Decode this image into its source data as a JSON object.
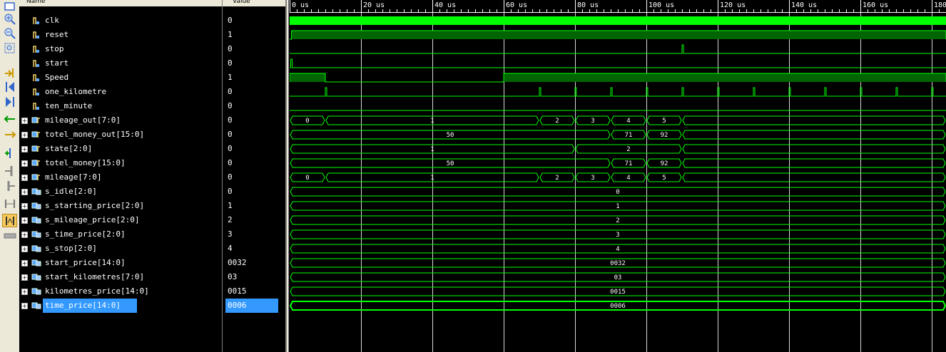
{
  "columns": {
    "name": "Name",
    "value": "Value"
  },
  "toolbar": {
    "buttons": [
      "zoom-fit-icon",
      "zoom-in-icon",
      "zoom-out-icon",
      "zoom-full-icon",
      "goto-cursor-icon",
      "goto-start-icon",
      "goto-end-icon",
      "prev-transition-icon",
      "next-transition-icon",
      "add-marker-icon",
      "prev-marker-icon",
      "next-marker-icon",
      "swap-cursors-icon",
      "snap-to-transition-icon",
      "float-ruler-icon"
    ]
  },
  "timeline": {
    "labels": [
      "0 us",
      "20 us",
      "40 us",
      "60 us",
      "80 us",
      "100 us",
      "120 us",
      "140 us",
      "160 us",
      "180"
    ]
  },
  "signals": [
    {
      "name": "clk",
      "value": "0",
      "kind": "bit",
      "wave": {
        "type": "clock"
      }
    },
    {
      "name": "reset",
      "value": "1",
      "kind": "bit",
      "wave": {
        "type": "level",
        "high": [
          [
            0.5,
            184
          ]
        ]
      }
    },
    {
      "name": "stop",
      "value": "0",
      "kind": "bit",
      "wave": {
        "type": "pulses",
        "at": [
          110
        ]
      }
    },
    {
      "name": "start",
      "value": "0",
      "kind": "bit",
      "wave": {
        "type": "pulses",
        "at": [
          0.3
        ]
      }
    },
    {
      "name": "Speed",
      "value": "1",
      "kind": "bit",
      "wave": {
        "type": "level",
        "high": [
          [
            0,
            10
          ],
          [
            60,
            184
          ]
        ]
      }
    },
    {
      "name": "one_kilometre",
      "value": "0",
      "kind": "bit",
      "wave": {
        "type": "pulses",
        "at": [
          10,
          70,
          80,
          90,
          100,
          110,
          120,
          130,
          140,
          150,
          160,
          170,
          180
        ]
      }
    },
    {
      "name": "ten_minute",
      "value": "0",
      "kind": "bit",
      "wave": {
        "type": "low"
      }
    },
    {
      "name": "mileage_out[7:0]",
      "value": "0",
      "kind": "bus",
      "wave": {
        "type": "bus",
        "segments": [
          [
            0,
            10,
            "0"
          ],
          [
            10,
            70,
            "1"
          ],
          [
            70,
            80,
            "2"
          ],
          [
            80,
            90,
            "3"
          ],
          [
            90,
            100,
            "4"
          ],
          [
            100,
            110,
            "5"
          ],
          [
            110,
            184,
            ""
          ]
        ]
      }
    },
    {
      "name": "totel_money_out[15:0]",
      "value": "0",
      "kind": "bus",
      "wave": {
        "type": "bus",
        "segments": [
          [
            0,
            90,
            "50"
          ],
          [
            90,
            100,
            "71"
          ],
          [
            100,
            110,
            "92"
          ],
          [
            110,
            184,
            ""
          ]
        ]
      }
    },
    {
      "name": "state[2:0]",
      "value": "0",
      "kind": "bus",
      "wave": {
        "type": "bus",
        "segments": [
          [
            0,
            80,
            "1"
          ],
          [
            80,
            110,
            "2"
          ],
          [
            110,
            184,
            ""
          ]
        ]
      }
    },
    {
      "name": "totel_money[15:0]",
      "value": "0",
      "kind": "bus",
      "wave": {
        "type": "bus",
        "segments": [
          [
            0,
            90,
            "50"
          ],
          [
            90,
            100,
            "71"
          ],
          [
            100,
            110,
            "92"
          ],
          [
            110,
            184,
            ""
          ]
        ]
      }
    },
    {
      "name": "mileage[7:0]",
      "value": "0",
      "kind": "bus",
      "wave": {
        "type": "bus",
        "segments": [
          [
            0,
            10,
            "0"
          ],
          [
            10,
            70,
            "1"
          ],
          [
            70,
            80,
            "2"
          ],
          [
            80,
            90,
            "3"
          ],
          [
            90,
            100,
            "4"
          ],
          [
            100,
            110,
            "5"
          ],
          [
            110,
            184,
            ""
          ]
        ]
      }
    },
    {
      "name": "s_idle[2:0]",
      "value": "0",
      "kind": "param",
      "wave": {
        "type": "bus",
        "segments": [
          [
            0,
            184,
            "0"
          ]
        ]
      }
    },
    {
      "name": "s_starting_price[2:0]",
      "value": "1",
      "kind": "param",
      "wave": {
        "type": "bus",
        "segments": [
          [
            0,
            184,
            "1"
          ]
        ]
      }
    },
    {
      "name": "s_mileage_price[2:0]",
      "value": "2",
      "kind": "param",
      "wave": {
        "type": "bus",
        "segments": [
          [
            0,
            184,
            "2"
          ]
        ]
      }
    },
    {
      "name": "s_time_price[2:0]",
      "value": "3",
      "kind": "param",
      "wave": {
        "type": "bus",
        "segments": [
          [
            0,
            184,
            "3"
          ]
        ]
      }
    },
    {
      "name": "s_stop[2:0]",
      "value": "4",
      "kind": "param",
      "wave": {
        "type": "bus",
        "segments": [
          [
            0,
            184,
            "4"
          ]
        ]
      }
    },
    {
      "name": "start_price[14:0]",
      "value": "0032",
      "kind": "param",
      "wave": {
        "type": "bus",
        "segments": [
          [
            0,
            184,
            "0032"
          ]
        ]
      }
    },
    {
      "name": "start_kilometres[7:0]",
      "value": "03",
      "kind": "param",
      "wave": {
        "type": "bus",
        "segments": [
          [
            0,
            184,
            "03"
          ]
        ]
      }
    },
    {
      "name": "kilometres_price[14:0]",
      "value": "0015",
      "kind": "param",
      "wave": {
        "type": "bus",
        "segments": [
          [
            0,
            184,
            "0015"
          ]
        ]
      }
    },
    {
      "name": "time_price[14:0]",
      "value": "0006",
      "kind": "param",
      "selected": true,
      "wave": {
        "type": "bus",
        "segments": [
          [
            0,
            184,
            "0006"
          ]
        ]
      }
    }
  ],
  "colors": {
    "wave": "#00ff00",
    "wave_fill": "#006400",
    "selection": "#3399ff",
    "grid": "#ffffff"
  }
}
